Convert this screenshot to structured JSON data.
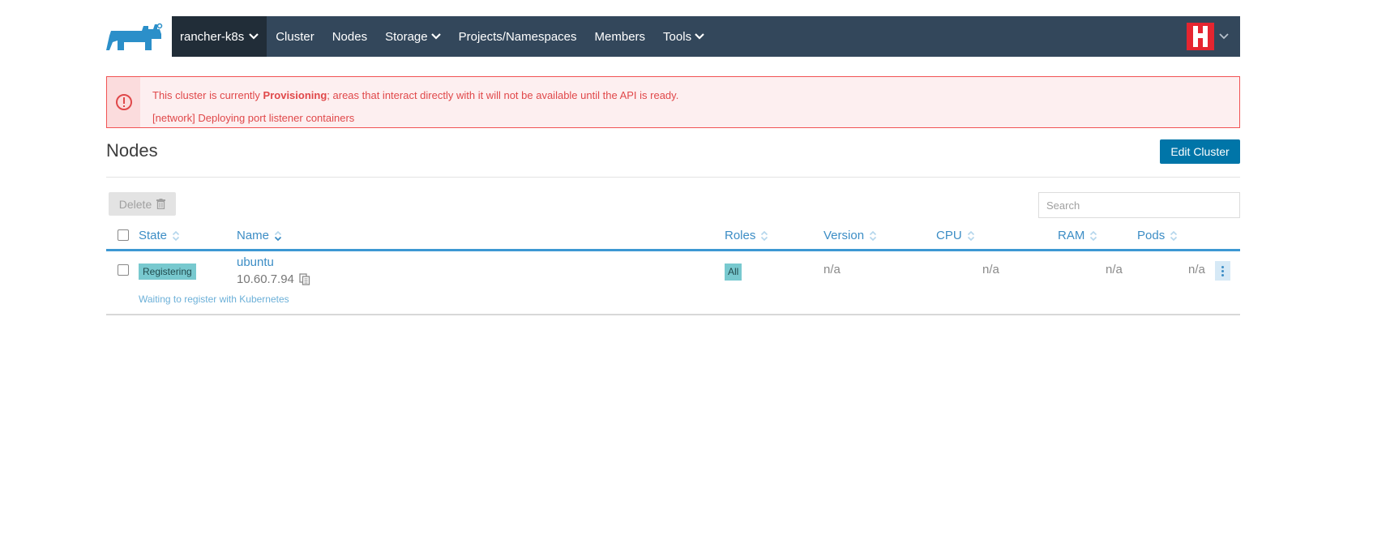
{
  "header": {
    "cluster_name": "rancher-k8s",
    "nav": {
      "cluster": "Cluster",
      "nodes": "Nodes",
      "storage": "Storage",
      "projects": "Projects/Namespaces",
      "members": "Members",
      "tools": "Tools"
    }
  },
  "banner": {
    "prefix": "This cluster is currently ",
    "state": "Provisioning",
    "suffix": "; areas that interact directly with it will not be available until the API is ready.",
    "detail": "[network] Deploying port listener containers"
  },
  "page": {
    "title": "Nodes",
    "edit_button": "Edit Cluster",
    "delete_button": "Delete",
    "search_placeholder": "Search"
  },
  "table": {
    "columns": {
      "state": "State",
      "name": "Name",
      "roles": "Roles",
      "version": "Version",
      "cpu": "CPU",
      "ram": "RAM",
      "pods": "Pods"
    },
    "rows": [
      {
        "state": "Registering",
        "name": "ubuntu",
        "ip": "10.60.7.94",
        "roles": "All",
        "version": "n/a",
        "cpu": "n/a",
        "ram": "n/a",
        "pods": "n/a",
        "message": "Waiting to register with Kubernetes"
      }
    ]
  },
  "colors": {
    "nav_bg": "#33475b",
    "nav_active_bg": "#212d38",
    "primary": "#0075a8",
    "link": "#3c8dc5",
    "error": "#e0484a",
    "badge": "#78c9cf"
  },
  "icons": {
    "logo": "rancher-logo",
    "banner": "alert-circle-icon",
    "delete": "trash-icon",
    "copy": "copy-icon",
    "sort": "sort-icon",
    "more": "kebab-menu-icon"
  }
}
